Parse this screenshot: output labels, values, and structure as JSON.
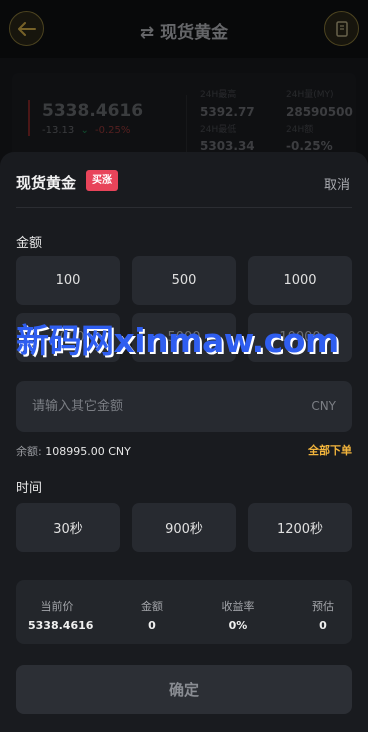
{
  "nav": {
    "title": "现货黄金",
    "swap_icon": "⇄",
    "back_icon": "back-arrow-icon",
    "doc_icon": "document-icon"
  },
  "quote": {
    "price": "5338.4616",
    "change": "-13.13",
    "change_pct": "-0.25%",
    "stats": [
      {
        "label": "24H最高",
        "value": "5392.77"
      },
      {
        "label": "24H量(MY)",
        "value": "28590500"
      },
      {
        "label": "24H最低",
        "value": "5303.34"
      },
      {
        "label": "24H额",
        "value": "-0.25%"
      }
    ]
  },
  "sheet": {
    "title": "现货黄金",
    "badge": "买涨",
    "cancel": "取消",
    "amount_label": "金额",
    "amounts": [
      "100",
      "500",
      "1000",
      "2000",
      "5000",
      "10000"
    ],
    "input_placeholder": "请输入其它金额",
    "input_unit": "CNY",
    "balance_label": "余额:",
    "balance_value": "108995.00 CNY",
    "all_in": "全部下单",
    "time_label": "时间",
    "times": [
      "30秒",
      "900秒",
      "1200秒"
    ],
    "summary": [
      {
        "label": "当前价",
        "value": "5338.4616"
      },
      {
        "label": "金额",
        "value": "0"
      },
      {
        "label": "收益率",
        "value": "0%"
      },
      {
        "label": "预估",
        "value": "0"
      }
    ],
    "confirm": "确定"
  },
  "watermark": "新码网xinmaw.com",
  "colors": {
    "accent_gold": "#f3b53c",
    "badge_red": "#e8445a",
    "up_green": "#1f8a55",
    "down_red": "#9a3a3a"
  }
}
